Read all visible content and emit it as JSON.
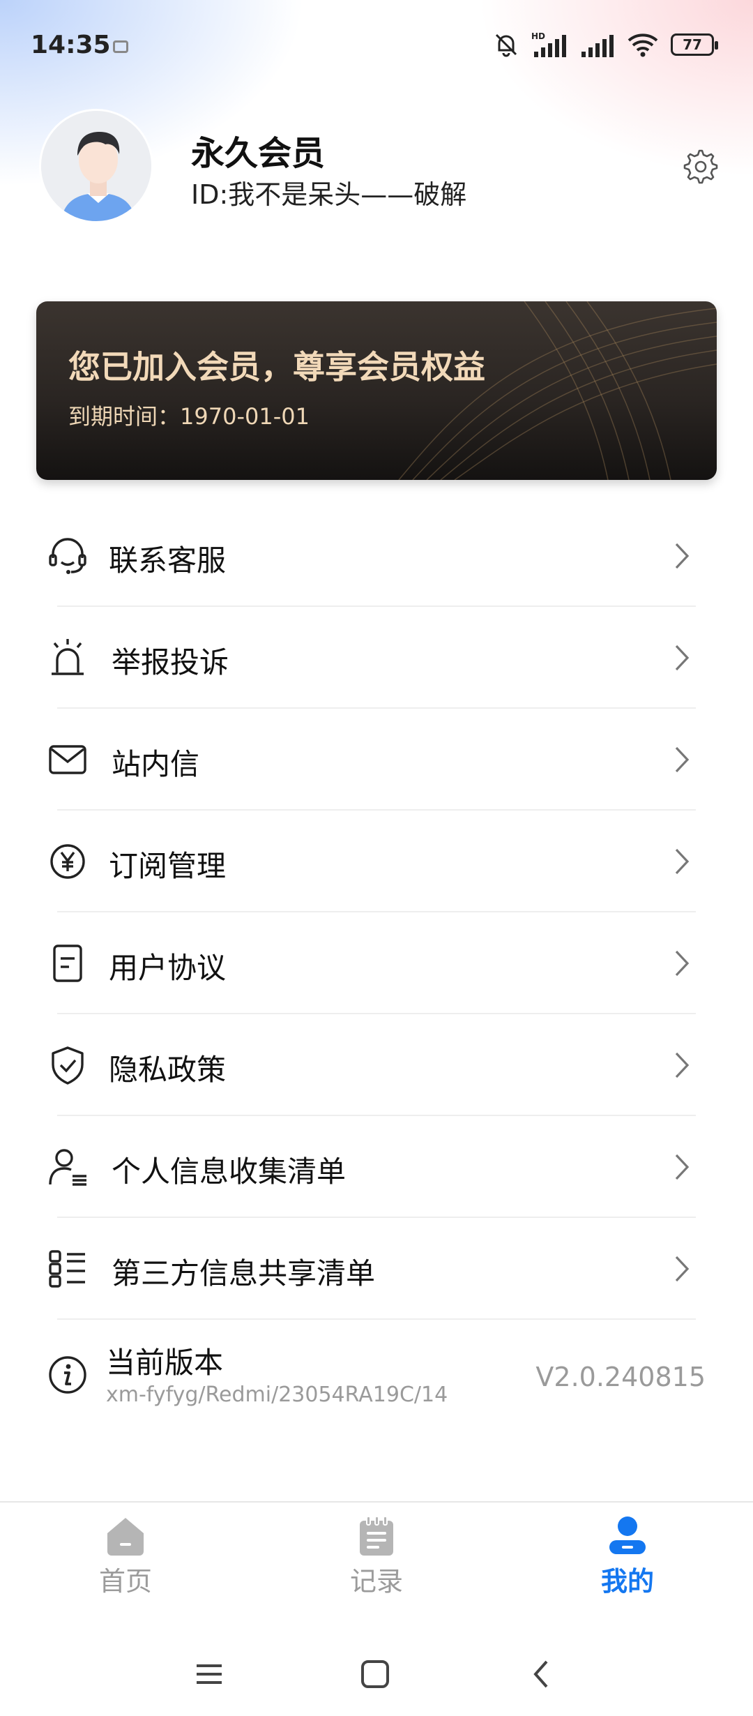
{
  "status_bar": {
    "time": "14:35",
    "battery": "77",
    "network_badge": "HD",
    "icons": [
      "mute-bell-icon",
      "signal-hd-icon",
      "signal-icon",
      "wifi-icon",
      "battery-icon"
    ]
  },
  "profile": {
    "title": "永久会员",
    "id_text": "ID:我不是呆头——破解"
  },
  "member_card": {
    "headline": "您已加入会员，尊享会员权益",
    "expire": "到期时间：1970-01-01",
    "colors": {
      "text": "#f2d9b9",
      "bg": "#2a2522"
    }
  },
  "menu": [
    {
      "label": "联系客服",
      "icon": "headset-icon"
    },
    {
      "label": "举报投诉",
      "icon": "alarm-icon"
    },
    {
      "label": "站内信",
      "icon": "mail-icon"
    },
    {
      "label": "订阅管理",
      "icon": "yen-circle-icon"
    },
    {
      "label": "用户协议",
      "icon": "document-icon"
    },
    {
      "label": "隐私政策",
      "icon": "shield-check-icon"
    },
    {
      "label": "个人信息收集清单",
      "icon": "user-list-icon"
    },
    {
      "label": "第三方信息共享清单",
      "icon": "list-icon"
    }
  ],
  "version": {
    "label": "当前版本",
    "build": "xm-fyfyg/Redmi/23054RA19C/14",
    "value": "V2.0.240815"
  },
  "bottom_nav": {
    "items": [
      {
        "label": "首页",
        "icon": "home-icon",
        "active": false
      },
      {
        "label": "记录",
        "icon": "notepad-icon",
        "active": false
      },
      {
        "label": "我的",
        "icon": "profile-icon",
        "active": true
      }
    ],
    "accent": "#1477f0",
    "inactive": "#9b9b9b"
  }
}
